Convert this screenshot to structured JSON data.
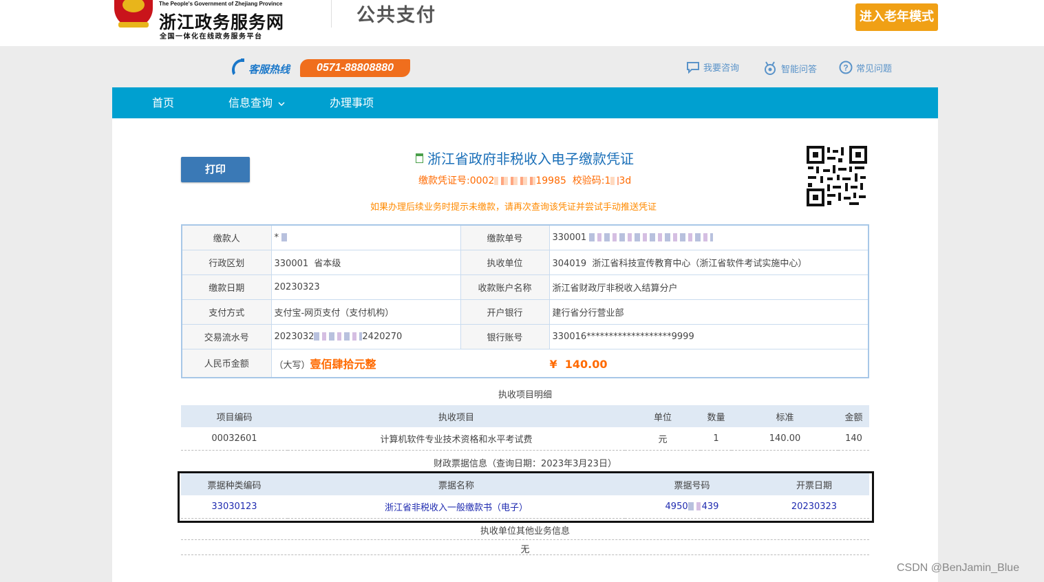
{
  "header": {
    "logo_en": "The People's Government of Zhejiang Province",
    "logo_cn": "浙江政务服务网",
    "logo_sub": "全国一体化在线政务服务平台",
    "page_title": "公共支付",
    "elder_mode": "进入老年模式"
  },
  "hotline": {
    "label": "客服热线",
    "number": "0571-88808880"
  },
  "quick_links": [
    "我要咨询",
    "智能问答",
    "常见问题"
  ],
  "nav": {
    "home": "首页",
    "info_query": "信息查询",
    "services": "办理事项"
  },
  "voucher": {
    "print": "打印",
    "title": "浙江省政府非税收入电子缴款凭证",
    "no_prefix": "缴款凭证号:0002",
    "no_suffix": "19985",
    "check_prefix": "校验码:1",
    "check_suffix": "3d",
    "warning": "如果办理后续业务时提示未缴款，请再次查询该凭证并尝试手动推送凭证"
  },
  "main_table": {
    "payer_label": "缴款人",
    "payer_value": "*",
    "bill_no_label": "缴款单号",
    "bill_no_value": "330001",
    "region_label": "行政区划",
    "region_value": "330001  省本级",
    "unit_label": "执收单位",
    "unit_value": "304019  浙江省科技宣传教育中心（浙江省软件考试实施中心）",
    "date_label": "缴款日期",
    "date_value": "20230323",
    "account_name_label": "收款账户名称",
    "account_name_value": "浙江省财政厅非税收入结算分户",
    "pay_method_label": "支付方式",
    "pay_method_value": "支付宝-网页支付（支付机构）",
    "bank_label": "开户银行",
    "bank_value": "建行省分行营业部",
    "txn_label": "交易流水号",
    "txn_prefix": "2023032",
    "txn_suffix": "2420270",
    "account_no_label": "银行账号",
    "account_no_value": "330016*******************9999",
    "amount_label": "人民币金额",
    "amount_cn_prefix": "（大写）",
    "amount_cn": "壹佰肆拾元整",
    "amount_num": "¥  140.00"
  },
  "items": {
    "section_title": "执收项目明细",
    "headers": [
      "项目编码",
      "执收项目",
      "单位",
      "数量",
      "标准",
      "金额"
    ],
    "rows": [
      [
        "00032601",
        "计算机软件专业技术资格和水平考试费",
        "元",
        "1",
        "140.00",
        "140"
      ]
    ]
  },
  "bill_info": {
    "section_title": "财政票据信息（查询日期：2023年3月23日）",
    "headers": [
      "票据种类编码",
      "票据名称",
      "票据号码",
      "开票日期"
    ],
    "rows": [
      [
        "33030123",
        "浙江省非税收入一般缴款书（电子）",
        "4950",
        "439",
        "20230323"
      ]
    ]
  },
  "other_info": {
    "section_title": "执收单位其他业务信息",
    "value": "无"
  },
  "watermark": "CSDN @BenJamin_Blue",
  "colors": {
    "nav_bg": "#00a0d0",
    "accent_orange": "#f0a015",
    "hotline_orange": "#f06e1d",
    "title_blue": "#1a6fb8"
  }
}
